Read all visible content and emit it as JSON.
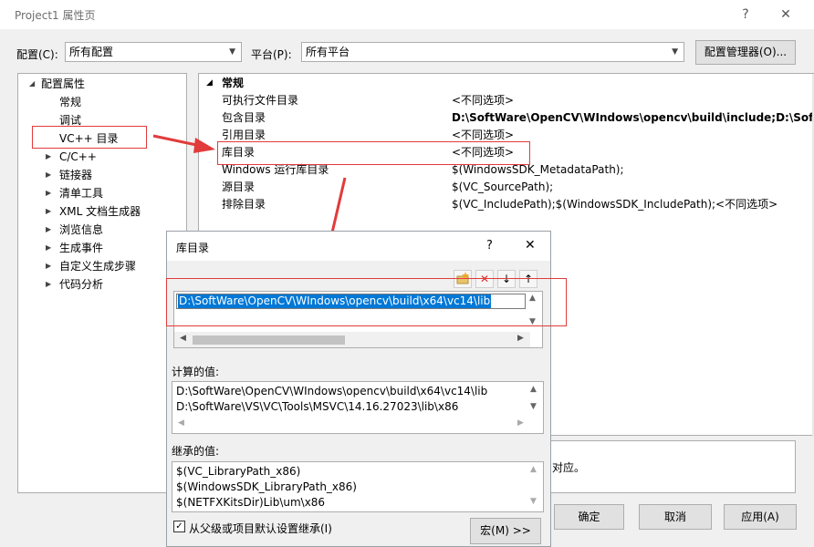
{
  "window": {
    "title": "Project1 属性页",
    "help": "?",
    "close": "✕"
  },
  "config": {
    "label": "配置(C):",
    "value": "所有配置",
    "platform_label": "平台(P):",
    "platform_value": "所有平台",
    "manager_button": "配置管理器(O)..."
  },
  "tree": {
    "root": "配置属性",
    "items": [
      "常规",
      "调试",
      "VC++ 目录",
      "C/C++",
      "链接器",
      "清单工具",
      "XML 文档生成器",
      "浏览信息",
      "生成事件",
      "自定义生成步骤",
      "代码分析"
    ]
  },
  "grid": {
    "section": "常规",
    "rows": [
      {
        "name": "可执行文件目录",
        "value": "<不同选项>"
      },
      {
        "name": "包含目录",
        "value": "D:\\SoftWare\\OpenCV\\WIndows\\opencv\\build\\include;D:\\Sof"
      },
      {
        "name": "引用目录",
        "value": "<不同选项>"
      },
      {
        "name": "库目录",
        "value": "<不同选项>"
      },
      {
        "name": "Windows 运行库目录",
        "value": "$(WindowsSDK_MetadataPath);"
      },
      {
        "name": "源目录",
        "value": "$(VC_SourcePath);"
      },
      {
        "name": "排除目录",
        "value": "$(VC_IncludePath);$(WindowsSDK_IncludePath);<不同选项>"
      }
    ]
  },
  "bottom": {
    "desc_tail": "对应。",
    "ok": "确定",
    "cancel": "取消",
    "apply": "应用(A)"
  },
  "dialog": {
    "title": "库目录",
    "help": "?",
    "close": "✕",
    "edit_value": "D:\\SoftWare\\OpenCV\\WIndows\\opencv\\build\\x64\\vc14\\lib",
    "computed_label": "计算的值:",
    "computed": [
      "D:\\SoftWare\\OpenCV\\WIndows\\opencv\\build\\x64\\vc14\\lib",
      "D:\\SoftWare\\VS\\VC\\Tools\\MSVC\\14.16.27023\\lib\\x86"
    ],
    "inherited_label": "继承的值:",
    "inherited": [
      "$(VC_LibraryPath_x86)",
      "$(WindowsSDK_LibraryPath_x86)",
      "$(NETFXKitsDir)Lib\\um\\x86"
    ],
    "inherit_checkbox": "从父级或项目默认设置继承(I)",
    "macro_button": "宏(M) >>"
  },
  "colors": {
    "annotation": "#e23b3b",
    "selection": "#0078d7"
  }
}
